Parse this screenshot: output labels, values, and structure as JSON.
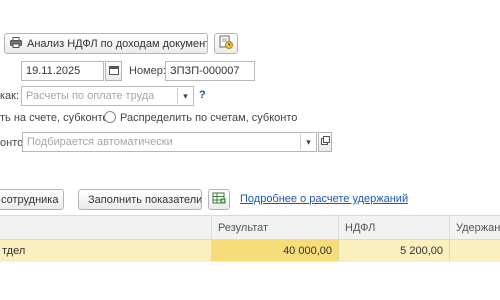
{
  "toolbar": {
    "analysis_button": "Анализ НДФЛ по доходам документа",
    "print_icon": "printer-icon",
    "report_icon": "report-clock-icon"
  },
  "header": {
    "date_value": "19.11.2025",
    "number_label": "Номер:",
    "number_value": "ЗПЗП-000007"
  },
  "reflect": {
    "label": "как:",
    "placeholder": "Расчеты по оплате труда",
    "help": "?"
  },
  "distribution": {
    "option1": "ть на счете, субконто",
    "option2": "Распределить по счетам, субконто"
  },
  "subconto": {
    "label": "онто:",
    "placeholder": "Подбирается автоматически"
  },
  "table_toolbar": {
    "employee_button": "сотрудника",
    "fill_button": "Заполнить показатели",
    "details_link": "Подробнее о расчете удержаний"
  },
  "table": {
    "columns": [
      "",
      "Результат",
      "НДФЛ",
      "Удержание"
    ],
    "rows": [
      {
        "name": "тдел",
        "result": "40 000,00",
        "ndfl": "5 200,00",
        "deduction": ""
      }
    ]
  }
}
